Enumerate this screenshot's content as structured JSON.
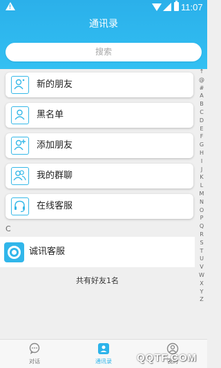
{
  "status_bar": {
    "time": "11:07",
    "warning_mark": "!"
  },
  "header": {
    "title": "通讯录"
  },
  "search": {
    "placeholder": "搜索"
  },
  "menu": [
    {
      "label": "新的朋友",
      "icon": "new-friend-icon"
    },
    {
      "label": "黑名单",
      "icon": "blacklist-icon"
    },
    {
      "label": "添加朋友",
      "icon": "add-friend-icon"
    },
    {
      "label": "我的群聊",
      "icon": "group-chat-icon"
    },
    {
      "label": "在线客服",
      "icon": "headset-icon"
    }
  ],
  "section": {
    "header": "C"
  },
  "contacts": [
    {
      "name": "诚讯客服",
      "icon": "camera-avatar-icon"
    }
  ],
  "friend_count_text": "共有好友1名",
  "index_letters": [
    "↑",
    "@",
    "#",
    "A",
    "B",
    "C",
    "D",
    "E",
    "F",
    "G",
    "H",
    "I",
    "J",
    "K",
    "L",
    "M",
    "N",
    "O",
    "P",
    "Q",
    "R",
    "S",
    "T",
    "U",
    "V",
    "W",
    "X",
    "Y",
    "Z"
  ],
  "bottom_nav": [
    {
      "label": "对话",
      "icon": "chat-bubble-icon",
      "active": false
    },
    {
      "label": "通讯录",
      "icon": "contacts-icon",
      "active": true
    },
    {
      "label": "我的",
      "icon": "profile-icon",
      "active": false
    }
  ],
  "watermark": "QQTF.COM",
  "colors": {
    "primary": "#2cb3ea",
    "background": "#efefef",
    "card": "#ffffff"
  }
}
